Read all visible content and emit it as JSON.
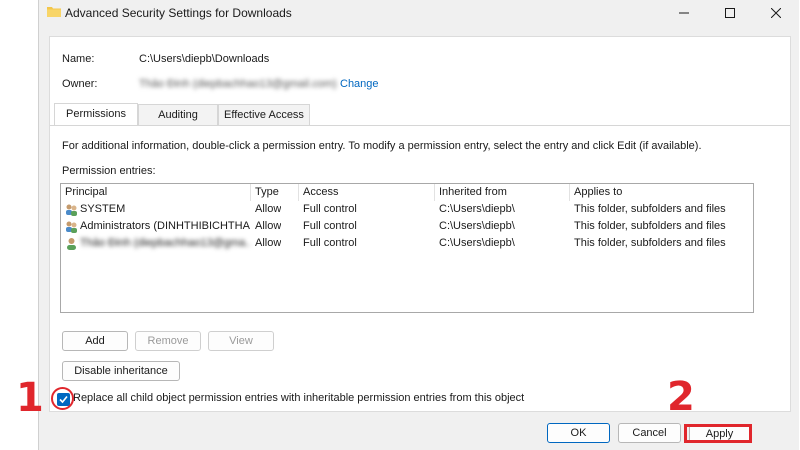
{
  "window": {
    "title": "Advanced Security Settings for Downloads"
  },
  "info": {
    "name_label": "Name:",
    "name_value": "C:\\Users\\diepb\\Downloads",
    "owner_label": "Owner:",
    "owner_value": "Thảo Đinh (diepbachhao13@gmail.com)",
    "change_link": "Change"
  },
  "tabs": [
    {
      "label": "Permissions",
      "active": true
    },
    {
      "label": "Auditing",
      "active": false
    },
    {
      "label": "Effective Access",
      "active": false
    }
  ],
  "description": "For additional information, double-click a permission entry. To modify a permission entry, select the entry and click Edit (if available).",
  "entries_label": "Permission entries:",
  "columns": [
    "Principal",
    "Type",
    "Access",
    "Inherited from",
    "Applies to"
  ],
  "entries": [
    {
      "principal": "SYSTEM",
      "type": "Allow",
      "access": "Full control",
      "inherited": "C:\\Users\\diepb\\",
      "applies": "This folder, subfolders and files",
      "icon": "user-group-icon"
    },
    {
      "principal": "Administrators (DINHTHIBICHTHA...",
      "type": "Allow",
      "access": "Full control",
      "inherited": "C:\\Users\\diepb\\",
      "applies": "This folder, subfolders and files",
      "icon": "user-group-icon"
    },
    {
      "principal": "Thảo Đinh (diepbachhao13@gma...",
      "type": "Allow",
      "access": "Full control",
      "inherited": "C:\\Users\\diepb\\",
      "applies": "This folder, subfolders and files",
      "icon": "user-icon"
    }
  ],
  "buttons": {
    "add": "Add",
    "remove": "Remove",
    "view": "View",
    "disable_inheritance": "Disable inheritance",
    "ok": "OK",
    "cancel": "Cancel",
    "apply": "Apply"
  },
  "replace_checkbox": {
    "label": "Replace all child object permission entries with inheritable permission entries from this object",
    "checked": true
  },
  "annotations": {
    "step1": "1",
    "step2": "2",
    "highlight_color": "#e0262c"
  },
  "colors": {
    "accent": "#0067c0"
  }
}
